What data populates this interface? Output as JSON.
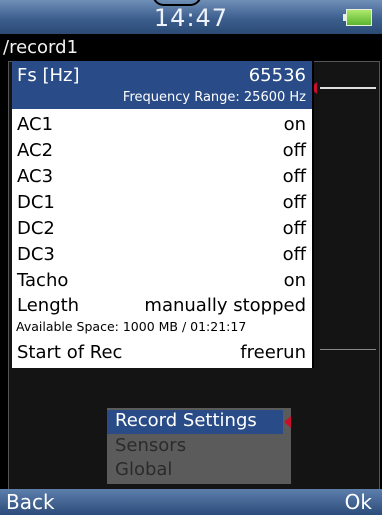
{
  "status": {
    "time": "14:47"
  },
  "path": "/record1",
  "dialog": {
    "fs": {
      "label": "Fs [Hz]",
      "value": "65536",
      "range_text": "Frequency Range: 25600 Hz"
    },
    "rows": [
      {
        "label": "AC1",
        "value": "on"
      },
      {
        "label": "AC2",
        "value": "off"
      },
      {
        "label": "AC3",
        "value": "off"
      },
      {
        "label": "DC1",
        "value": "off"
      },
      {
        "label": "DC2",
        "value": "off"
      },
      {
        "label": "DC3",
        "value": "off"
      },
      {
        "label": "Tacho",
        "value": "on"
      },
      {
        "label": "Length",
        "value": "manually stopped"
      }
    ],
    "available_space": "Available Space: 1000 MB / 01:21:17",
    "start": {
      "label": "Start of Rec",
      "value": "freerun"
    }
  },
  "menu": {
    "items": [
      {
        "label": "Record Settings"
      },
      {
        "label": "Sensors"
      },
      {
        "label": "Global"
      }
    ]
  },
  "softkeys": {
    "left": "Back",
    "right": "Ok"
  },
  "colors": {
    "highlight": "#294b87",
    "marker": "#c8102e",
    "status_bar": "#3d5f8e"
  }
}
